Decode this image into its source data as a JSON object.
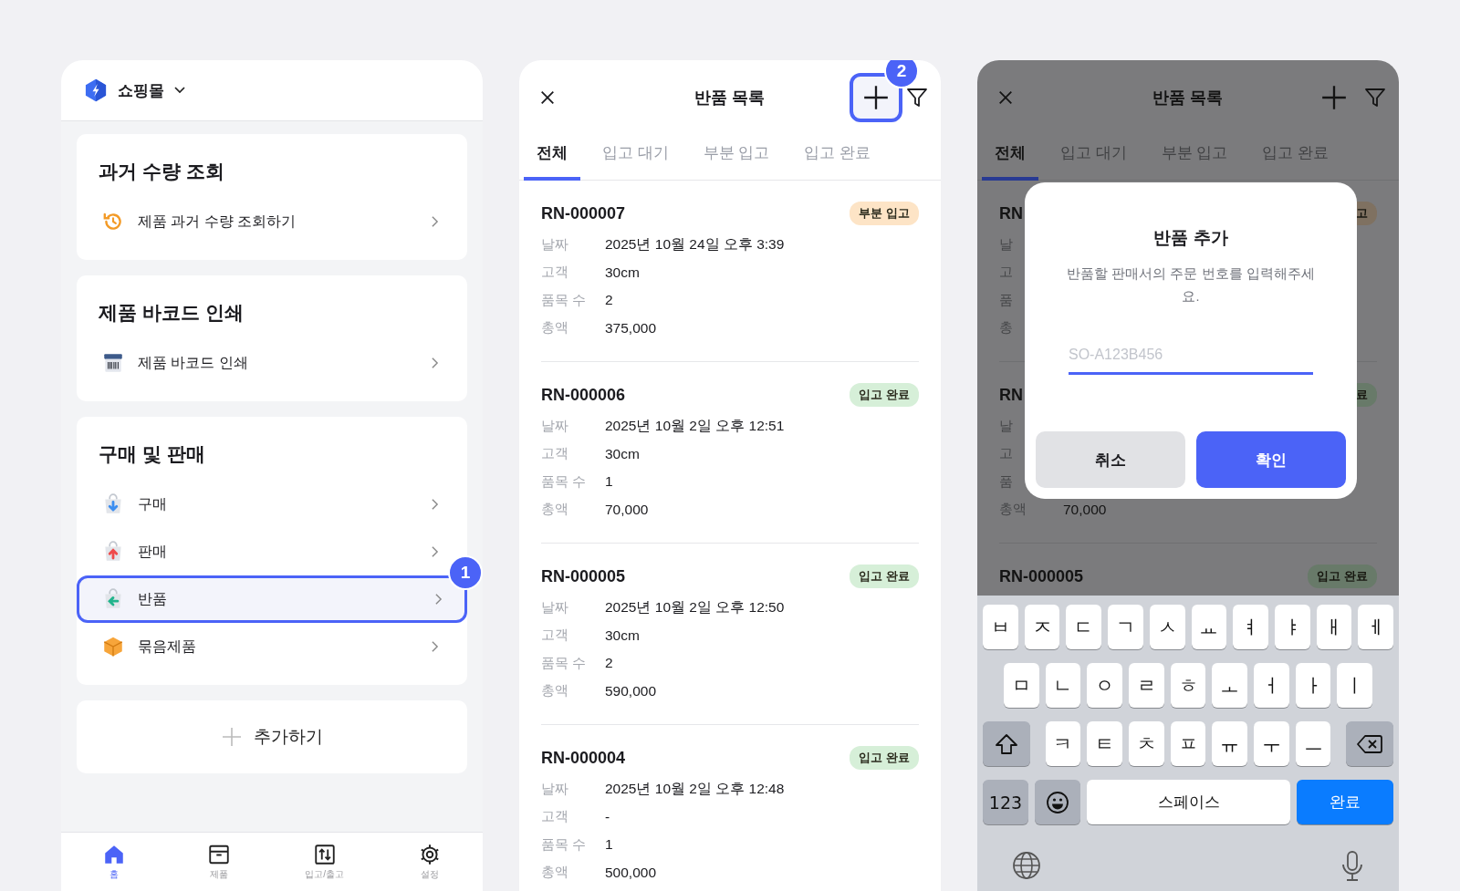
{
  "home": {
    "store_name": "쇼핑몰",
    "step_badge": "1",
    "add_label": "추가하기",
    "sections": [
      {
        "title": "과거 수량 조회",
        "items": [
          {
            "kind": "history",
            "label": "제품 과거 수량 조회하기",
            "selected": false
          }
        ]
      },
      {
        "title": "제품 바코드 인쇄",
        "items": [
          {
            "kind": "barcode",
            "label": "제품 바코드 인쇄",
            "selected": false
          }
        ]
      },
      {
        "title": "구매 및 판매",
        "items": [
          {
            "kind": "purchase",
            "label": "구매",
            "selected": false
          },
          {
            "kind": "sale",
            "label": "판매",
            "selected": false
          },
          {
            "kind": "return",
            "label": "반품",
            "selected": true
          },
          {
            "kind": "bundle",
            "label": "묶음제품",
            "selected": false
          }
        ]
      }
    ],
    "nav": [
      {
        "kind": "home",
        "label": "홈",
        "selected": true
      },
      {
        "kind": "product",
        "label": "제품",
        "selected": false
      },
      {
        "kind": "inout",
        "label": "입고/출고",
        "selected": false
      },
      {
        "kind": "settings",
        "label": "설정",
        "selected": false
      }
    ]
  },
  "returns_list": {
    "title": "반품 목록",
    "add_highlighted": true,
    "step_badge": "2",
    "tabs": [
      {
        "label": "전체",
        "selected": true
      },
      {
        "label": "입고 대기",
        "selected": false
      },
      {
        "label": "부분 입고",
        "selected": false
      },
      {
        "label": "입고 완료",
        "selected": false
      }
    ],
    "items": [
      {
        "id": "RN-000007",
        "status": "부분 입고",
        "color": "#fde4c6",
        "fields": [
          {
            "label": "날짜",
            "value": "2025년 10월 24일 오후 3:39"
          },
          {
            "label": "고객",
            "value": "30cm"
          },
          {
            "label": "품목 수",
            "value": "2"
          },
          {
            "label": "총액",
            "value": "375,000"
          }
        ]
      },
      {
        "id": "RN-000006",
        "status": "입고 완료",
        "color": "#d6efd8",
        "fields": [
          {
            "label": "날짜",
            "value": "2025년 10월 2일 오후 12:51"
          },
          {
            "label": "고객",
            "value": "30cm"
          },
          {
            "label": "품목 수",
            "value": "1"
          },
          {
            "label": "총액",
            "value": "70,000"
          }
        ]
      },
      {
        "id": "RN-000005",
        "status": "입고 완료",
        "color": "#d6efd8",
        "fields": [
          {
            "label": "날짜",
            "value": "2025년 10월 2일 오후 12:50"
          },
          {
            "label": "고객",
            "value": "30cm"
          },
          {
            "label": "품목 수",
            "value": "2"
          },
          {
            "label": "총액",
            "value": "590,000"
          }
        ]
      },
      {
        "id": "RN-000004",
        "status": "입고 완료",
        "color": "#d6efd8",
        "fields": [
          {
            "label": "날짜",
            "value": "2025년 10월 2일 오후 12:48"
          },
          {
            "label": "고객",
            "value": "-"
          },
          {
            "label": "품목 수",
            "value": "1"
          },
          {
            "label": "총액",
            "value": "500,000"
          }
        ]
      }
    ]
  },
  "add_return": {
    "title": "반품 목록",
    "tabs": [
      {
        "label": "전체",
        "selected": true
      },
      {
        "label": "입고 대기",
        "selected": false
      },
      {
        "label": "부분 입고",
        "selected": false
      },
      {
        "label": "입고 완료",
        "selected": false
      }
    ],
    "items": [
      {
        "id": "RN",
        "status": "고",
        "color": "#7f7161",
        "fields": [
          {
            "label": "날"
          },
          {
            "label": "고"
          },
          {
            "label": "품"
          },
          {
            "label": "총"
          }
        ]
      },
      {
        "id": "RN",
        "status": "료",
        "color": "#687a69",
        "fields": [
          {
            "label": "날"
          },
          {
            "label": "고"
          },
          {
            "label": "품"
          },
          {
            "label": "총액",
            "value": "70,000"
          }
        ]
      },
      {
        "id": "RN-000005",
        "status": "입고 완료",
        "color": "#687a69"
      }
    ],
    "dialog": {
      "title": "반품 추가",
      "message": "반품할 판매서의 주문 번호를 입력해주세요.",
      "placeholder": "SO-A123B456",
      "buttons": [
        {
          "label": "취소",
          "kind": "cancel"
        },
        {
          "label": "확인",
          "kind": "confirm"
        }
      ]
    },
    "keyboard": {
      "rows": [
        [
          "ㅂ",
          "ㅈ",
          "ㄷ",
          "ㄱ",
          "ㅅ",
          "ㅛ",
          "ㅕ",
          "ㅑ",
          "ㅐ",
          "ㅔ"
        ],
        [
          "ㅁ",
          "ㄴ",
          "ㅇ",
          "ㄹ",
          "ㅎ",
          "ㅗ",
          "ㅓ",
          "ㅏ",
          "ㅣ"
        ],
        [
          "ㅋ",
          "ㅌ",
          "ㅊ",
          "ㅍ",
          "ㅠ",
          "ㅜ",
          "ㅡ"
        ]
      ],
      "numbers_key": "123",
      "space_key": "스페이스",
      "return_key": "완료"
    }
  }
}
